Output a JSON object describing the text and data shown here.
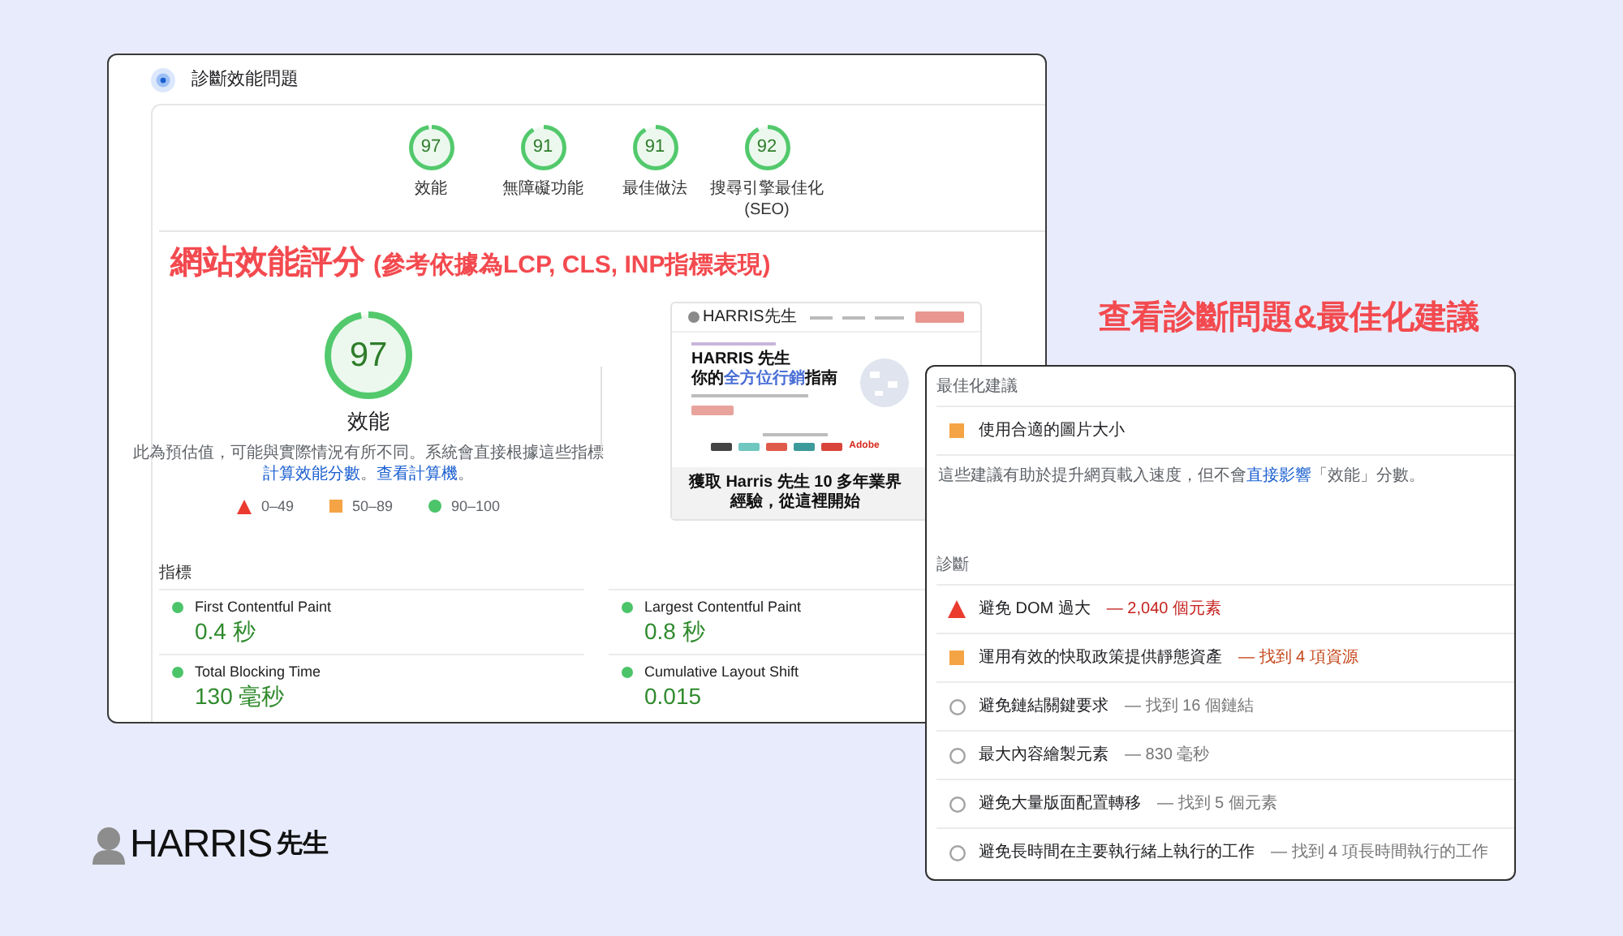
{
  "main_panel": {
    "title": "診斷效能問題",
    "scores": [
      {
        "value": "97",
        "label": "效能",
        "level": 0.97
      },
      {
        "value": "91",
        "label": "無障礙功能",
        "level": 0.91
      },
      {
        "value": "91",
        "label": "最佳做法",
        "level": 0.91
      },
      {
        "value": "92",
        "label": "搜尋引擎最佳化 (SEO)",
        "level": 0.92
      }
    ],
    "heading": {
      "title": "網站效能評分",
      "note": "(參考依據為LCP, CLS, INP指標表現)"
    },
    "performance": {
      "value": "97",
      "level": 0.97,
      "label": "效能",
      "description": [
        {
          "text": "此為預估值，可能與實際情況有所不同。系統會直接根據這些指標",
          "link": false
        },
        {
          "text": "計算效能分數",
          "link": true
        },
        {
          "text": "。",
          "link": false
        },
        {
          "text": "查看計算機",
          "link": true
        },
        {
          "text": "。",
          "link": false
        }
      ]
    },
    "legend": [
      {
        "kind": "fail",
        "range": "0–49"
      },
      {
        "kind": "average",
        "range": "50–89"
      },
      {
        "kind": "pass",
        "range": "90–100"
      }
    ],
    "site_preview": {
      "logo": "HARRIS先生",
      "headline": "HARRIS 先生",
      "tagline": [
        {
          "text": "你的",
          "highlight": false
        },
        {
          "text": "全方位行銷",
          "highlight": true
        },
        {
          "text": "指南",
          "highlight": false
        }
      ],
      "brand": "Adobe",
      "banner": "獲取 Harris 先生 10 多年業界經驗，從這裡開始"
    },
    "metrics_title": "指標",
    "metrics": [
      {
        "kind": "pass",
        "label": "First Contentful Paint",
        "value": "0.4 秒"
      },
      {
        "kind": "pass",
        "label": "Largest Contentful Paint",
        "value": "0.8 秒"
      },
      {
        "kind": "pass",
        "label": "Total Blocking Time",
        "value": "130 毫秒"
      },
      {
        "kind": "pass",
        "label": "Cumulative Layout Shift",
        "value": "0.015"
      }
    ]
  },
  "callout": "查看診斷問題&最佳化建議",
  "audit_panel": {
    "opportunities_title": "最佳化建議",
    "opportunities": [
      {
        "kind": "average",
        "title": "使用合適的圖片大小"
      }
    ],
    "note": [
      {
        "text": "這些建議有助於提升網頁載入速度，但不會",
        "link": false
      },
      {
        "text": "直接影響",
        "link": true
      },
      {
        "text": "「效能」分數。",
        "link": false
      }
    ],
    "diagnostics_title": "診斷",
    "diagnostics": [
      {
        "kind": "fail",
        "title": "避免 DOM 過大",
        "detail": "— 2,040 個元素"
      },
      {
        "kind": "average",
        "title": "運用有效的快取政策提供靜態資產",
        "detail": "— 找到 4 項資源"
      },
      {
        "kind": "info",
        "title": "避免鏈結關鍵要求",
        "detail": "— 找到 16 個鏈結"
      },
      {
        "kind": "info",
        "title": "最大內容繪製元素",
        "detail": "— 830 毫秒"
      },
      {
        "kind": "info",
        "title": "避免大量版面配置轉移",
        "detail": "— 找到 5 個元素"
      },
      {
        "kind": "info",
        "title": "避免長時間在主要執行緒上執行的工作",
        "detail": "— 找到 4 項長時間執行的工作"
      }
    ]
  },
  "logo": {
    "wordmark": "HARRIS",
    "suffix": "先生"
  }
}
